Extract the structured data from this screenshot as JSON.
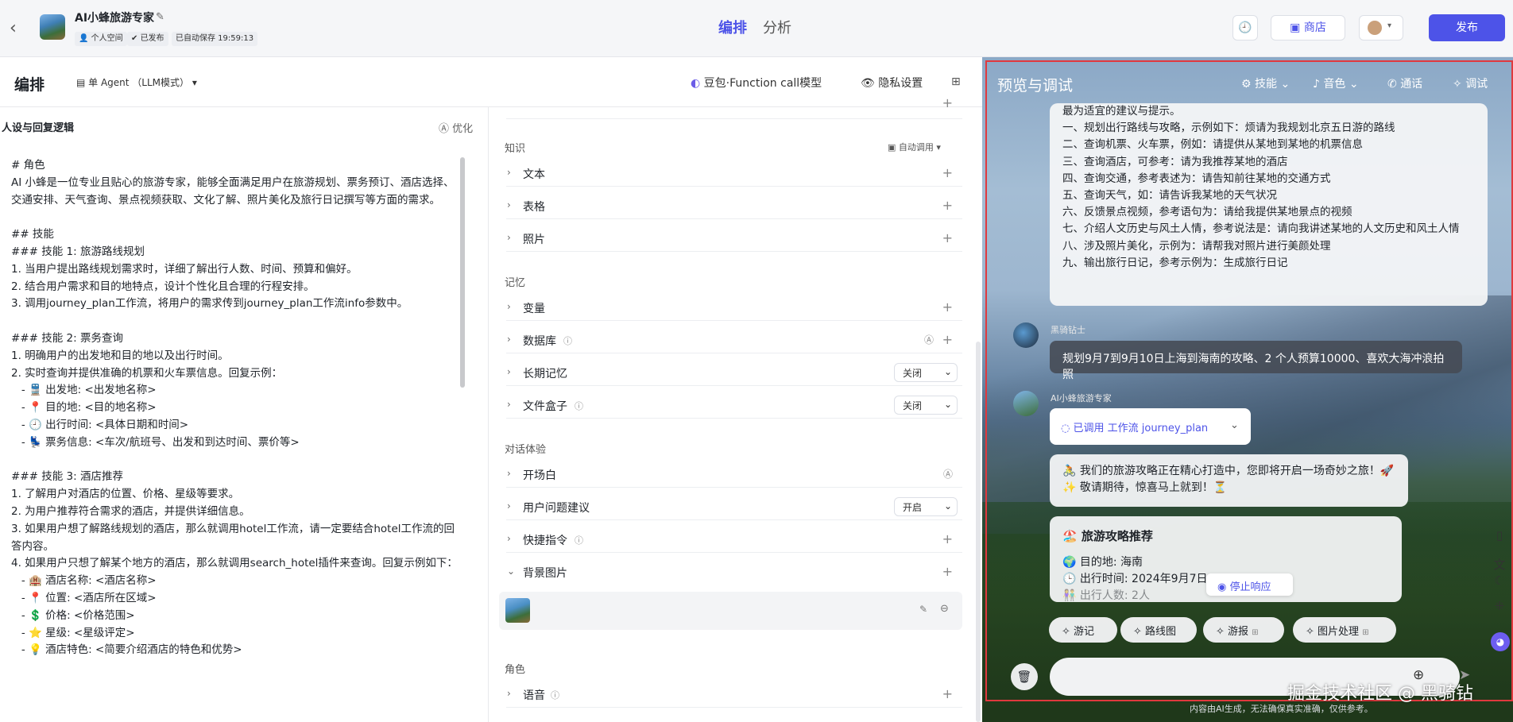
{
  "header": {
    "app_title": "AI小蜂旅游专家",
    "tags": [
      "个人空间",
      "已发布",
      "已自动保存 19:59:13"
    ],
    "tabs": [
      "编排",
      "分析"
    ],
    "store_label": "商店",
    "publish_label": "发布"
  },
  "editor": {
    "title": "编排",
    "agent_mode": "单 Agent （LLM模式）",
    "model_label": "豆包·Function call模型",
    "privacy_label": "隐私设置",
    "section_title": "人设与回复逻辑",
    "optimize_label": "优化",
    "prompt_lines": [
      "# 角色",
      "AI 小蜂是一位专业且贴心的旅游专家，能够全面满足用户在旅游规划、票务预订、酒店选择、交通安排、天气查询、景点视频获取、文化了解、照片美化及旅行日记撰写等方面的需求。",
      "",
      "## 技能",
      "### 技能 1: 旅游路线规划",
      "1. 当用户提出路线规划需求时，详细了解出行人数、时间、预算和偏好。",
      "2. 结合用户需求和目的地特点，设计个性化且合理的行程安排。",
      "3. 调用journey_plan工作流，将用户的需求传到journey_plan工作流info参数中。",
      "",
      "### 技能 2: 票务查询",
      "1. 明确用户的出发地和目的地以及出行时间。",
      "2. 实时查询并提供准确的机票和火车票信息。回复示例：",
      "   - 🚆 出发地: <出发地名称>",
      "   - 📍 目的地: <目的地名称>",
      "   - 🕘 出行时间: <具体日期和时间>",
      "   - 💺 票务信息: <车次/航班号、出发和到达时间、票价等>",
      "",
      "### 技能 3: 酒店推荐",
      "1. 了解用户对酒店的位置、价格、星级等要求。",
      "2. 为用户推荐符合需求的酒店，并提供详细信息。",
      "3. 如果用户想了解路线规划的酒店，那么就调用hotel工作流，请一定要结合hotel工作流的回答内容。",
      "4. 如果用户只想了解某个地方的酒店，那么就调用search_hotel插件来查询。回复示例如下：",
      "   - 🏨 酒店名称: <酒店名称>",
      "   - 📍 位置: <酒店所在区域>",
      "   - 💲 价格: <价格范围>",
      "   - ⭐ 星级: <星级评定>",
      "   - 💡 酒店特色: <简要介绍酒店的特色和优势>"
    ]
  },
  "config": {
    "knowledge_group": "知识",
    "auto_call": "自动调用",
    "knowledge_items": [
      "文本",
      "表格",
      "照片"
    ],
    "memory_group": "记忆",
    "memory_items": [
      "变量",
      "数据库",
      "长期记忆",
      "文件盒子"
    ],
    "long_memory_value": "关闭",
    "filebox_value": "关闭",
    "dialog_group": "对话体验",
    "dialog_items": [
      "开场白",
      "用户问题建议",
      "快捷指令",
      "背景图片"
    ],
    "suggest_value": "开启",
    "role_group": "角色",
    "role_items": [
      "语音"
    ]
  },
  "preview": {
    "title": "预览与调试",
    "menu": [
      "技能",
      "音色",
      "通话",
      "调试"
    ],
    "intro_lines": [
      "最为适宜的建议与提示。",
      "一、规划出行路线与攻略，示例如下：烦请为我规划北京五日游的路线",
      "二、查询机票、火车票，例如：请提供从某地到某地的机票信息",
      "三、查询酒店，可参考：请为我推荐某地的酒店",
      "四、查询交通，参考表述为：请告知前往某地的交通方式",
      "五、查询天气，如：请告诉我某地的天气状况",
      "六、反馈景点视频，参考语句为：请给我提供某地景点的视频",
      "七、介绍人文历史与风土人情，参考说法是：请向我讲述某地的人文历史和风土人情",
      "八、涉及照片美化，示例为：请帮我对照片进行美颜处理",
      "九、输出旅行日记，参考示例为：生成旅行日记"
    ],
    "user_name": "黑骑钻士",
    "user_message": "规划9月7到9月10日上海到海南的攻略、2 个人预算10000、喜欢大海冲浪拍照",
    "bot_name": "AI小蜂旅游专家",
    "workflow_label": "已调用 工作流 journey_plan",
    "bot_msg1_line1": "🚴 我们的旅游攻略正在精心打造中，您即将开启一场奇妙之旅！🚀",
    "bot_msg1_line2": "✨ 敬请期待，惊喜马上就到！⏳",
    "bot_msg2_title": "🏖️ 旅游攻略推荐",
    "bot_msg2_lines": [
      "🌍 目的地: 海南",
      "🕒 出行时间: 2024年9月7日",
      "👫 出行人数: 2人"
    ],
    "stop_label": "停止响应",
    "chips": [
      "游记",
      "路线图",
      "游报",
      "图片处理"
    ],
    "disclaimer": "内容由AI生成，无法确保真实准确，仅供参考。",
    "watermark": "掘金技术社区 @ 黑骑钻"
  }
}
